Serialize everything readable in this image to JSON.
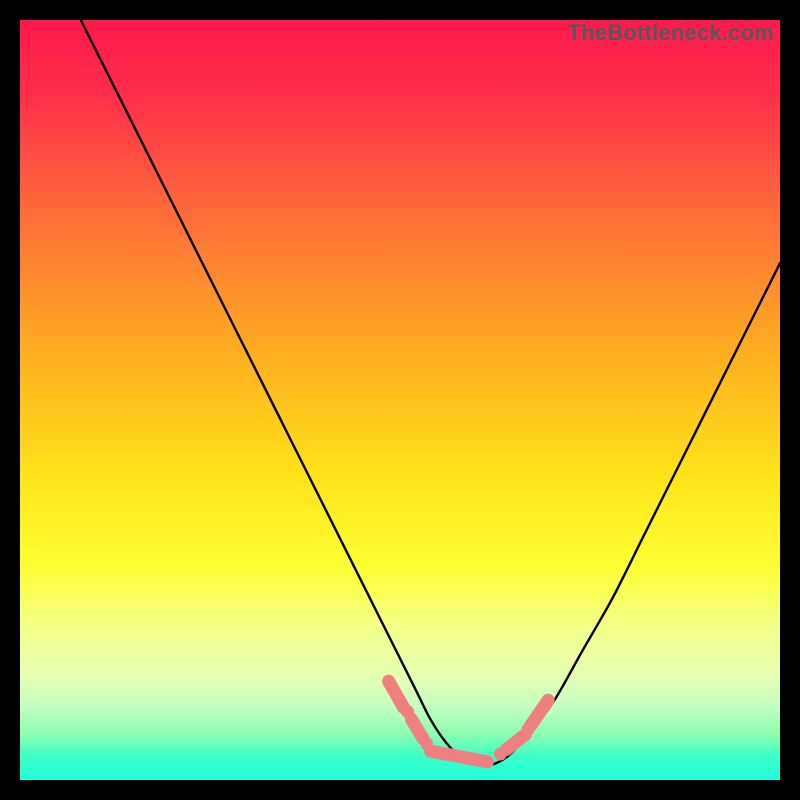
{
  "watermark": "TheBottleneck.com",
  "chart_data": {
    "type": "line",
    "title": "",
    "xlabel": "",
    "ylabel": "",
    "xlim": [
      0,
      100
    ],
    "ylim": [
      0,
      100
    ],
    "gradient_stops": [
      {
        "offset": 0.0,
        "color": "#ff1a4d"
      },
      {
        "offset": 0.1,
        "color": "#ff2e4a"
      },
      {
        "offset": 0.25,
        "color": "#ff6a3a"
      },
      {
        "offset": 0.45,
        "color": "#ffb21f"
      },
      {
        "offset": 0.6,
        "color": "#ffe31a"
      },
      {
        "offset": 0.72,
        "color": "#ffff33"
      },
      {
        "offset": 0.8,
        "color": "#f4ff8a"
      },
      {
        "offset": 0.86,
        "color": "#e6ffb0"
      },
      {
        "offset": 0.9,
        "color": "#c8ffc0"
      },
      {
        "offset": 0.94,
        "color": "#8affb0"
      },
      {
        "offset": 0.97,
        "color": "#3affc8"
      },
      {
        "offset": 1.0,
        "color": "#1fffe0"
      }
    ],
    "series": [
      {
        "name": "curve",
        "x": [
          8,
          12,
          16,
          20,
          24,
          28,
          32,
          36,
          40,
          44,
          48,
          52,
          54,
          56,
          58,
          60,
          62,
          64,
          66,
          70,
          74,
          78,
          82,
          86,
          90,
          94,
          98,
          100
        ],
        "y": [
          100,
          92,
          84,
          76,
          68,
          60,
          52,
          44,
          36,
          28,
          20,
          12,
          8,
          5,
          3,
          2,
          2,
          3,
          5,
          10,
          17,
          24,
          32,
          40,
          48,
          56,
          64,
          68
        ]
      }
    ],
    "markers": {
      "name": "pink-caps",
      "color": "#f08080",
      "segments": [
        {
          "x0": 48.5,
          "y0": 13,
          "x1": 50.5,
          "y1": 9.5
        },
        {
          "x0": 51.5,
          "y0": 8,
          "x1": 53.0,
          "y1": 5.5
        },
        {
          "x0": 54.0,
          "y0": 3.8,
          "x1": 61.5,
          "y1": 2.4
        },
        {
          "x0": 64.0,
          "y0": 4.0,
          "x1": 66.5,
          "y1": 6.0
        },
        {
          "x0": 67.2,
          "y0": 7.2,
          "x1": 69.5,
          "y1": 10.5
        }
      ],
      "dots": [
        {
          "x": 51.0,
          "y": 9.0
        },
        {
          "x": 53.5,
          "y": 4.8
        },
        {
          "x": 63.2,
          "y": 3.4
        },
        {
          "x": 66.8,
          "y": 6.6
        }
      ]
    }
  }
}
